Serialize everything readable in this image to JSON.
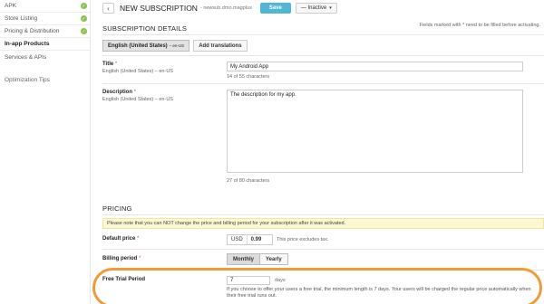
{
  "sidebar": {
    "items": [
      {
        "label": "APK",
        "checked": true
      },
      {
        "label": "Store Listing",
        "checked": true
      },
      {
        "label": "Pricing & Distribution",
        "checked": true
      },
      {
        "label": "In-app Products",
        "checked": false,
        "active": true
      },
      {
        "label": "Services & APIs",
        "checked": false
      }
    ],
    "footer_item": "Optimization Tips"
  },
  "header": {
    "back_icon": "chevron-left-icon",
    "title": "NEW SUBSCRIPTION",
    "subtitle": "- newsub.dmo.magplus",
    "save_label": "Save",
    "status_label": "— Inactive",
    "status_caret": "▾"
  },
  "details": {
    "heading": "SUBSCRIPTION DETAILS",
    "required_note": "Fields marked with * need to be filled before activating.",
    "language_button": "English (United States)",
    "language_code": "– en-US",
    "add_translations": "Add translations",
    "title_label": "Title",
    "title_req": "*",
    "title_lang": "English (United States) – en-US",
    "title_value": "My Android App",
    "title_counter": "14 of 55 characters",
    "desc_label": "Description",
    "desc_req": "*",
    "desc_lang": "English (United States) – en-US",
    "desc_value": "The description for my app.",
    "desc_counter": "27 of 80 characters"
  },
  "pricing": {
    "heading": "PRICING",
    "banner": "Please note that you can NOT change the price and billing period for your subscription after it was activated.",
    "default_price_label": "Default price",
    "default_price_req": "*",
    "currency": "USD",
    "amount": "0.99",
    "price_note": "This price excludes tax.",
    "billing_label": "Billing period",
    "billing_req": "*",
    "billing_options": [
      "Monthly",
      "Yearly"
    ],
    "billing_selected": "Monthly",
    "trial_label": "Free Trial Period",
    "trial_value": "7",
    "trial_unit": "days",
    "trial_help": "If you choose to offer your users a free trial, the minimum length is 7 days. Your users will be charged the regular price automatically when their free trial runs out."
  },
  "colors": {
    "accent": "#4fb6d6",
    "check": "#8bc34a",
    "highlight": "#f29b35",
    "banner": "#fcf8d0"
  }
}
